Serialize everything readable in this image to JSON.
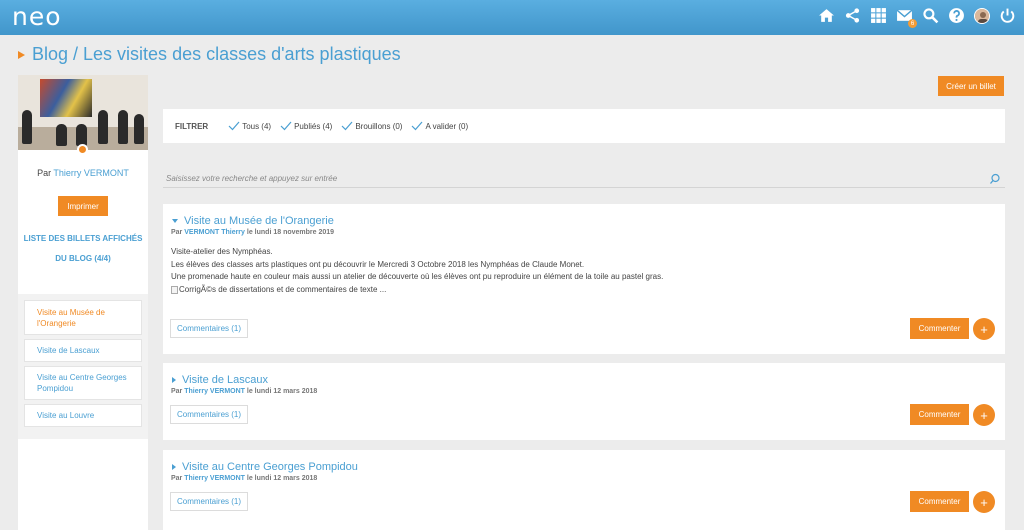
{
  "app": {
    "logo": "neo",
    "message_badge": "6"
  },
  "header_icons": [
    "home-icon",
    "share-icon",
    "apps-grid-icon",
    "mail-icon",
    "search-icon",
    "help-icon",
    "avatar",
    "power-icon"
  ],
  "colors": {
    "topbar": "#4a9fd2",
    "accent": "#f08a24",
    "link": "#4a9fd2"
  },
  "page": {
    "title": "Blog / Les visites des classes d'arts plastiques"
  },
  "sidebar": {
    "author_prefix": "Par",
    "author_name": "Thierry VERMONT",
    "print_label": "Imprimer",
    "list_title": "LISTE DES BILLETS AFFICHÉS DU BLOG (4/4)",
    "entries": [
      {
        "label": "Visite au Musée de l'Orangerie",
        "active": true
      },
      {
        "label": "Visite de Lascaux",
        "active": false
      },
      {
        "label": "Visite au Centre Georges Pompidou",
        "active": false
      },
      {
        "label": "Visite au Louvre",
        "active": false
      }
    ]
  },
  "toolbar": {
    "create_label": "Créer un billet"
  },
  "filter": {
    "label": "FILTRER",
    "items": [
      "Tous (4)",
      "Publiés (4)",
      "Brouillons (0)",
      "A valider (0)"
    ]
  },
  "search": {
    "placeholder": "Saisissez votre recherche et appuyez sur entrée"
  },
  "posts": [
    {
      "title": "Visite au Musée de l'Orangerie",
      "meta_prefix": "Par",
      "author": "VERMONT Thierry",
      "date": "le lundi 18 novembre 2019",
      "body": [
        "Visite-atelier des Nymphéas.",
        "Les élèves des classes arts plastiques ont pu découvrir le Mercredi 3 Octobre 2018 les Nymphéas de Claude Monet.",
        "Une promenade haute en couleur mais aussi un atelier de découverte où les élèves ont pu reproduire un élément de la toile au pastel gras."
      ],
      "broken_image_alt": "CorrigÃ©s de dissertations et de commentaires de texte ...",
      "comments_label": "Commentaires (1)",
      "comment_label": "Commenter",
      "plus_label": "+"
    },
    {
      "title": "Visite de Lascaux",
      "meta_prefix": "Par",
      "author": "Thierry VERMONT",
      "date": "le lundi 12 mars 2018",
      "comments_label": "Commentaires (1)",
      "comment_label": "Commenter",
      "plus_label": "+"
    },
    {
      "title": "Visite au Centre Georges Pompidou",
      "meta_prefix": "Par",
      "author": "Thierry VERMONT",
      "date": "le lundi 12 mars 2018",
      "comments_label": "Commentaires (1)",
      "comment_label": "Commenter",
      "plus_label": "+"
    }
  ]
}
